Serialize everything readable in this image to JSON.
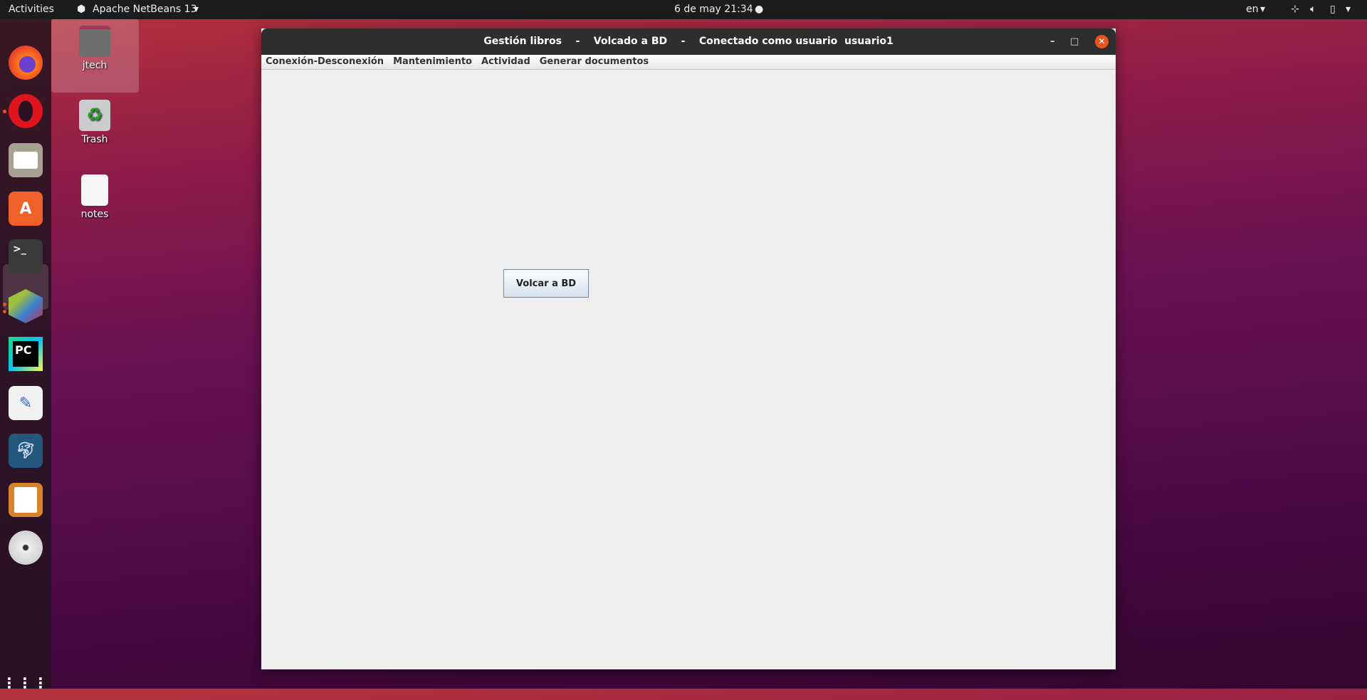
{
  "topbar": {
    "activities": "Activities",
    "app_menu": "Apache NetBeans 13",
    "clock": "6 de may  21:34",
    "language": "en"
  },
  "desktop": {
    "icons": [
      {
        "label": "jtech"
      },
      {
        "label": "Trash"
      },
      {
        "label": "notes"
      }
    ]
  },
  "dock": {
    "apps": [
      "firefox-icon",
      "opera-icon",
      "files-icon",
      "software-icon",
      "terminal-icon",
      "netbeans-icon",
      "pycharm-icon",
      "text-editor-icon",
      "mysql-workbench-icon",
      "libreoffice-draw-icon",
      "dvd-icon"
    ]
  },
  "window": {
    "title": "Gestión libros    -    Volcado a BD    -    Conectado como usuario  usuario1",
    "menu": [
      "Conexión-Desconexión",
      "Mantenimiento",
      "Actividad",
      "Generar documentos"
    ],
    "button": "Volcar a BD"
  },
  "colors": {
    "accent": "#e95420"
  }
}
